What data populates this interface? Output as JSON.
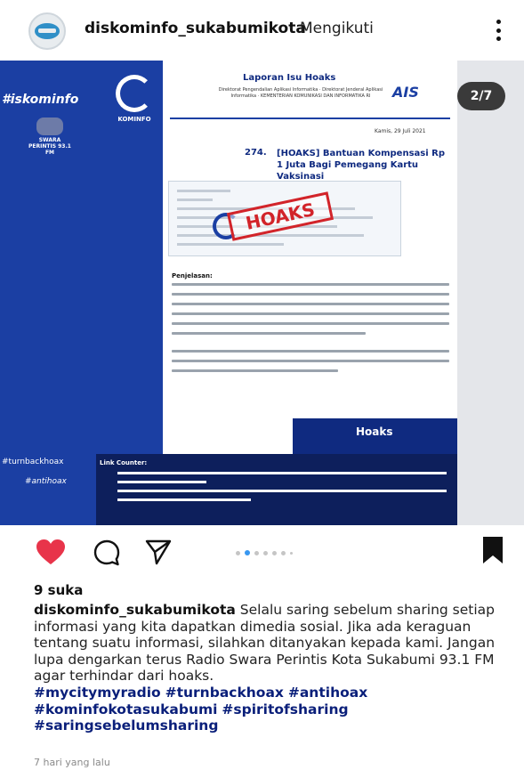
{
  "header": {
    "username": "diskominfo_sukabumikota",
    "separator": "·",
    "follow_status": "Mengikuti",
    "avatar_text": "",
    "more_icon": "more-vertical-icon"
  },
  "post": {
    "page_indicator": "2/7",
    "side_hashtag": "#iskominfo",
    "radio_logo_text": "SWARA PERINTIS 93.1 FM",
    "kominfo_logo_text": "KOMINFO",
    "doc": {
      "header_title": "Laporan Isu Hoaks",
      "header_subtitle": "Direktorat Pengendalian Aplikasi Informatika · Direktorat Jenderal Aplikasi Informatika · KEMENTERIAN KOMUNIKASI DAN INFORMATIKA RI",
      "brand": "AIS",
      "date": "Kamis, 29 Juli 2021",
      "number": "274.",
      "title": "[HOAKS] Bantuan Kompensasi Rp 1 Juta Bagi Pemegang Kartu Vaksinasi",
      "stamp": "HOAKS",
      "explanation_title": "Penjelasan:"
    },
    "hoaks_label": "Hoaks",
    "turnback_tag": "#turnbackhoax",
    "antihoax_tag": "#antihoax",
    "counter_label": "Link Counter:"
  },
  "actions": {
    "like_icon": "heart-icon",
    "comment_icon": "comment-icon",
    "share_icon": "share-icon",
    "save_icon": "bookmark-icon",
    "carousel_total": 7,
    "carousel_active": 2
  },
  "caption": {
    "likes": "9 suka",
    "username": "diskominfo_sukabumikota",
    "text": " Selalu saring sebelum sharing setiap informasi yang kita dapatkan dimedia sosial. Jika ada keraguan tentang suatu informasi, silahkan ditanyakan kepada kami. Jangan lupa dengarkan terus Radio Swara Perintis Kota Sukabumi 93.1 FM agar terhindar dari hoaks.",
    "hashtags": [
      "#mycitymyradio",
      "#turnbackhoax",
      "#antihoax",
      "#kominfokotasukabumi",
      "#spiritofsharing",
      "#saringsebelumsharing"
    ],
    "time": "7 hari yang lalu"
  },
  "colors": {
    "like": "#e8344a",
    "hashtag": "#0a1f7a",
    "kominfo_blue": "#1b3fa3",
    "stamp_red": "#d2242a",
    "carousel_active": "#3897f0"
  }
}
